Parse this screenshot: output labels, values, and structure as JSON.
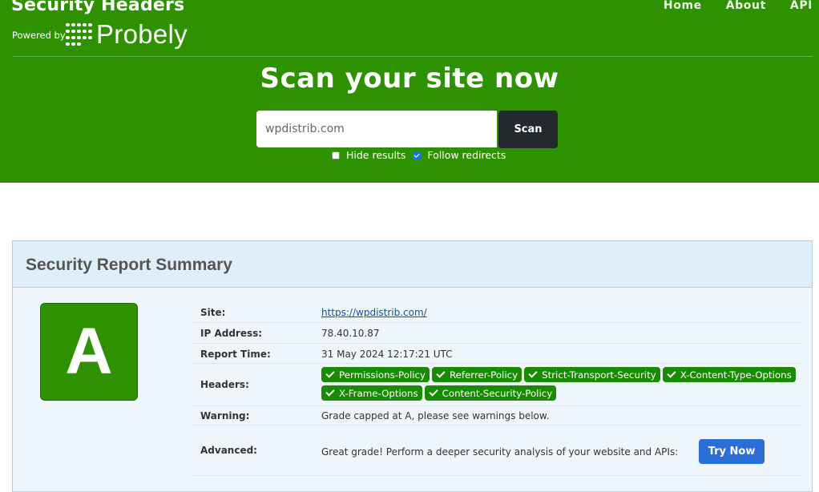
{
  "brand": {
    "title": "Security Headers",
    "powered_by": "Powered by",
    "logo_text": "Probely"
  },
  "nav": {
    "items": [
      "Home",
      "About",
      "API"
    ]
  },
  "hero": {
    "headline": "Scan your site now"
  },
  "scan": {
    "input_value": "wpdistrib.com",
    "button_label": "Scan",
    "options": [
      {
        "label": "Hide results",
        "checked": false
      },
      {
        "label": "Follow redirects",
        "checked": true
      }
    ]
  },
  "report": {
    "title": "Security Report Summary",
    "grade": "A",
    "rows": {
      "site": {
        "label": "Site:",
        "value": "https://wpdistrib.com/"
      },
      "ip": {
        "label": "IP Address:",
        "value": "78.40.10.87"
      },
      "time": {
        "label": "Report Time:",
        "value": "31 May 2024 12:17:21 UTC"
      },
      "headers": {
        "label": "Headers:",
        "items": [
          "Permissions-Policy",
          "Referrer-Policy",
          "Strict-Transport-Security",
          "X-Content-Type-Options",
          "X-Frame-Options",
          "Content-Security-Policy"
        ]
      },
      "warning": {
        "label": "Warning:",
        "value": "Grade capped at A, please see warnings below."
      },
      "advanced": {
        "label": "Advanced:",
        "value": "Great grade! Perform a deeper security analysis of your website and APIs:",
        "button_label": "Try Now"
      }
    }
  },
  "colors": {
    "hero_green": "#2e9200",
    "tag_green": "#1a8a00",
    "scan_button": "#24292e",
    "try_button": "#2b6fd6",
    "panel_bg": "#eef6fc",
    "panel_head_bg": "#dfeefb"
  }
}
